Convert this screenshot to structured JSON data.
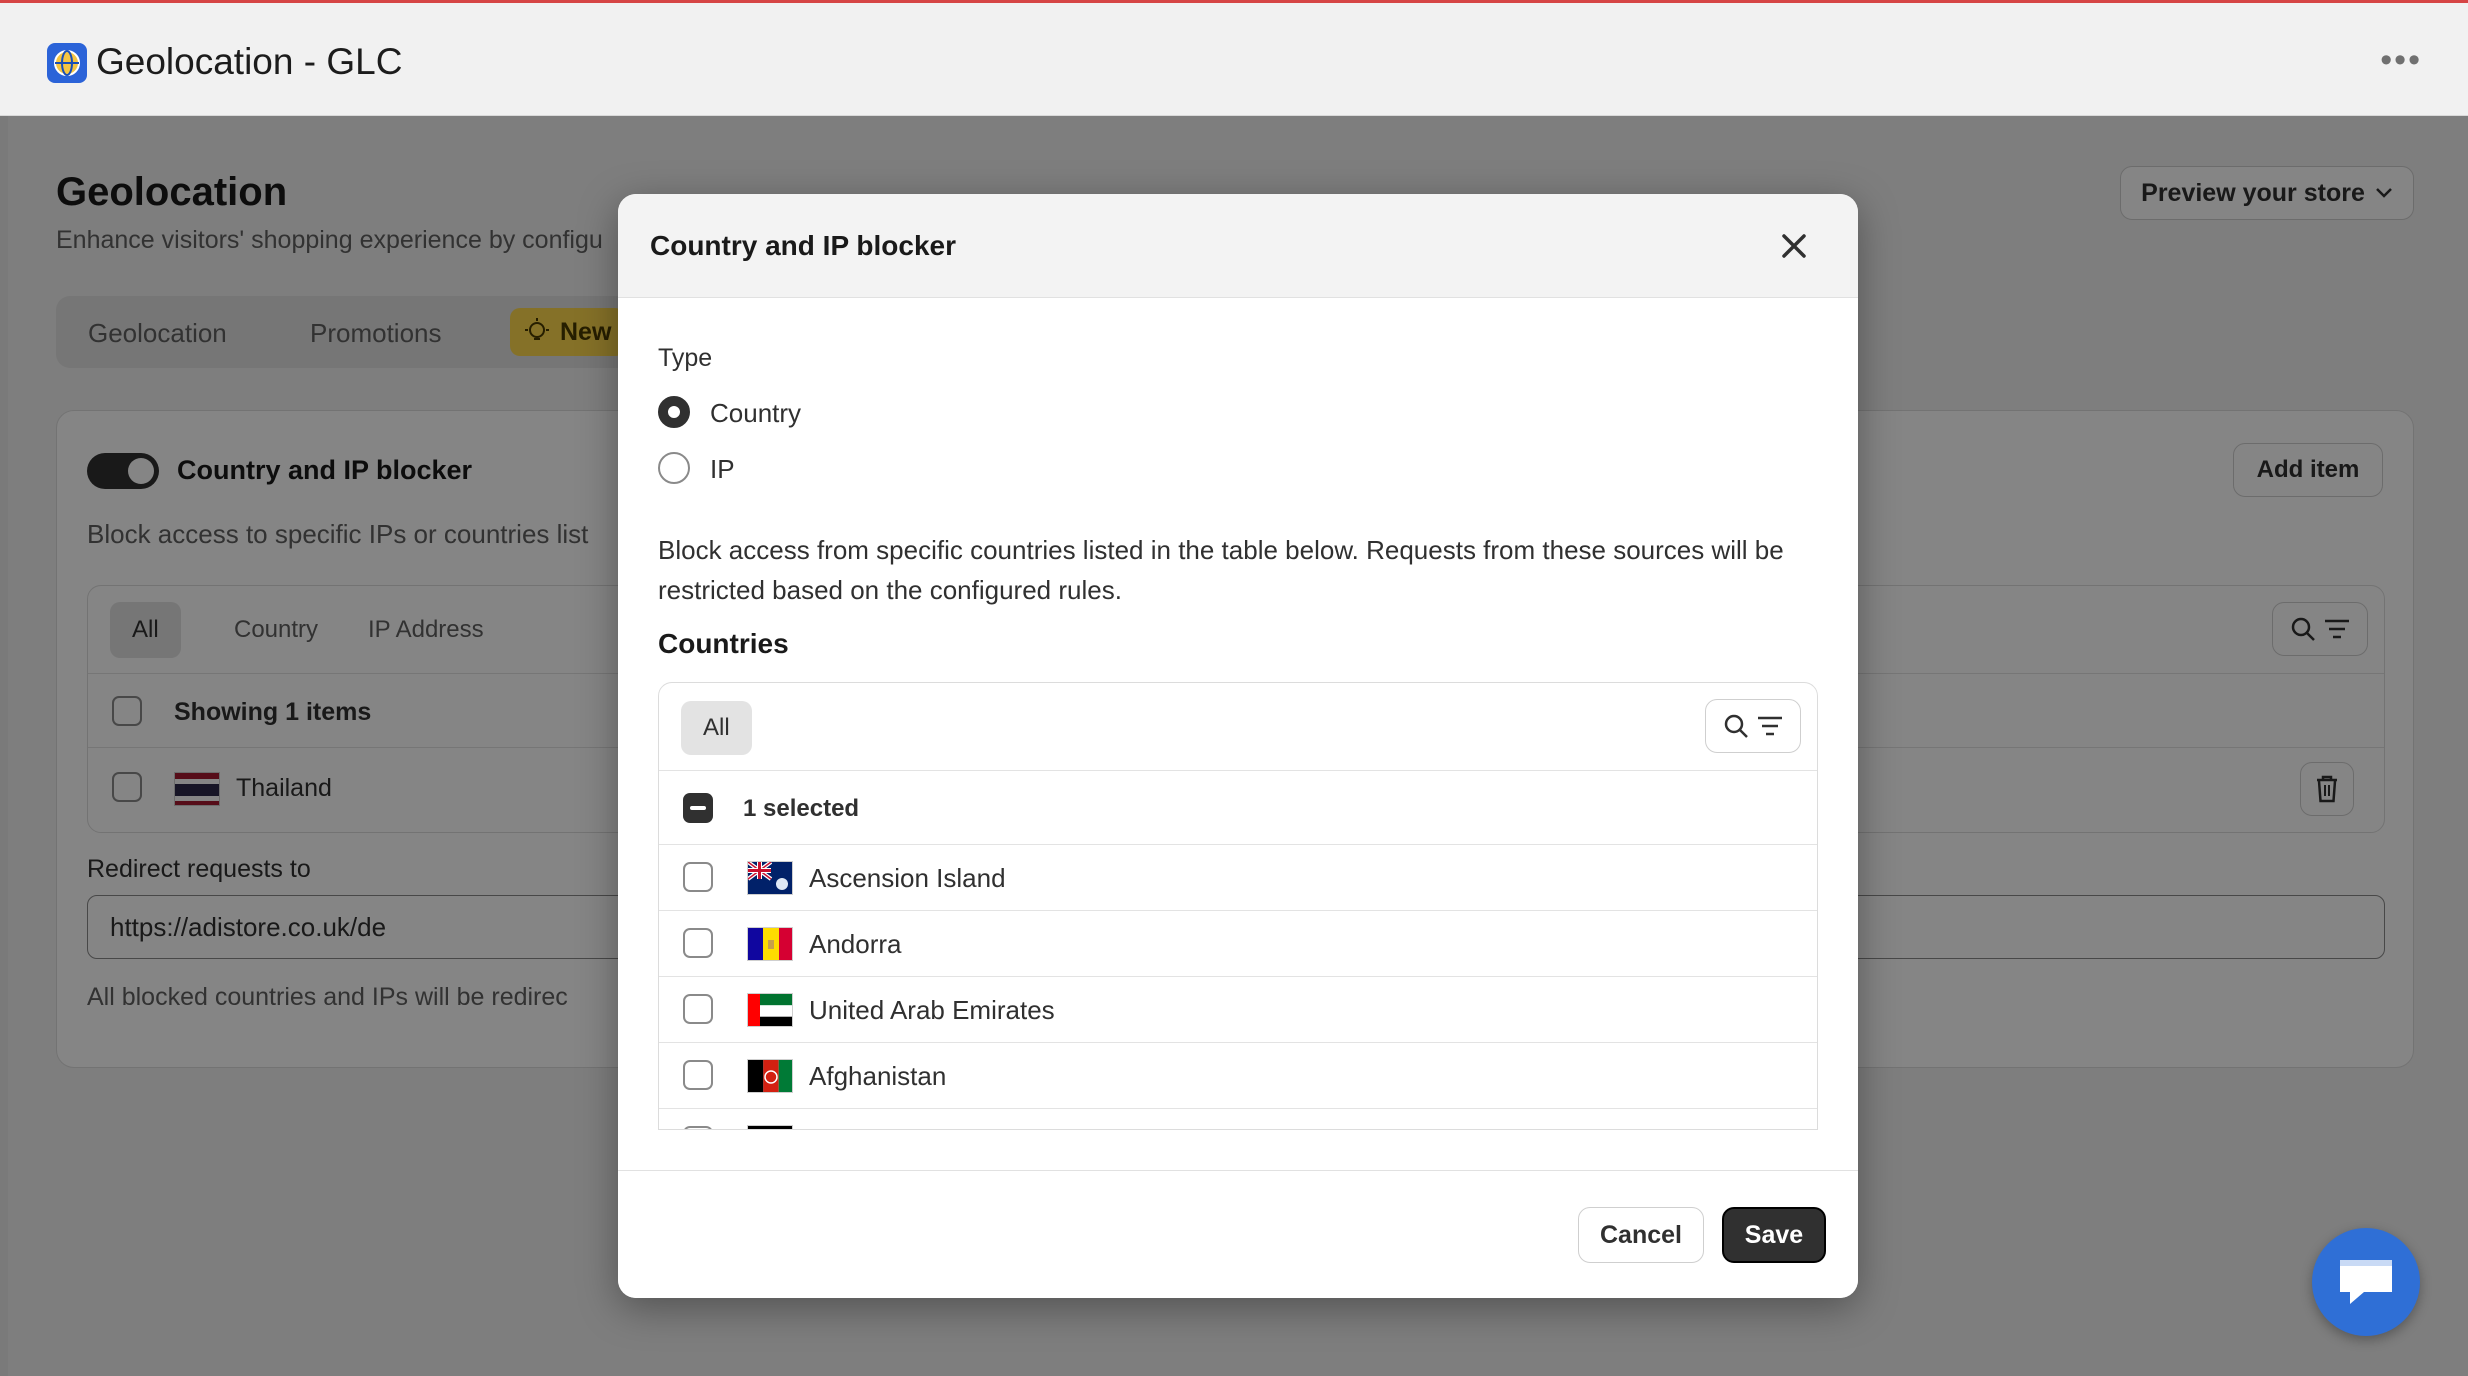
{
  "app": {
    "title": "Geolocation - GLC",
    "more_icon": "ellipsis-icon",
    "accent": "#2b63d8"
  },
  "page": {
    "title": "Geolocation",
    "subtitle": "Enhance visitors' shopping experience by configu",
    "preview_button": "Preview your store",
    "tabs": [
      {
        "label": "Geolocation"
      },
      {
        "label": "Promotions"
      }
    ],
    "new_badge": "New",
    "card": {
      "title": "Country and IP blocker",
      "toggle_on": true,
      "add_item": "Add item",
      "description": "Block access to specific IPs or countries list",
      "filter_tabs": [
        "All",
        "Country",
        "IP Address"
      ],
      "showing": "Showing 1 items",
      "rows": [
        {
          "name": "Thailand"
        }
      ],
      "redirect_label": "Redirect requests to",
      "redirect_value": "https://adistore.co.uk/de",
      "redirect_help": "All blocked countries and IPs will be redirec"
    }
  },
  "modal": {
    "title": "Country and IP blocker",
    "type_label": "Type",
    "type_options": [
      {
        "label": "Country",
        "checked": true
      },
      {
        "label": "IP",
        "checked": false
      }
    ],
    "description": "Block access from specific countries listed in the table below. Requests from these sources will be restricted based on the configured rules.",
    "countries_heading": "Countries",
    "filter_all": "All",
    "selected_text": "1 selected",
    "countries": [
      {
        "name": "Ascension Island",
        "checked": false
      },
      {
        "name": "Andorra",
        "checked": false
      },
      {
        "name": "United Arab Emirates",
        "checked": false
      },
      {
        "name": "Afghanistan",
        "checked": false
      }
    ],
    "cancel": "Cancel",
    "save": "Save"
  },
  "colors": {
    "primary_button": "#303030",
    "chat_button": "#2f6fd6",
    "new_badge": "#ffd94d"
  }
}
